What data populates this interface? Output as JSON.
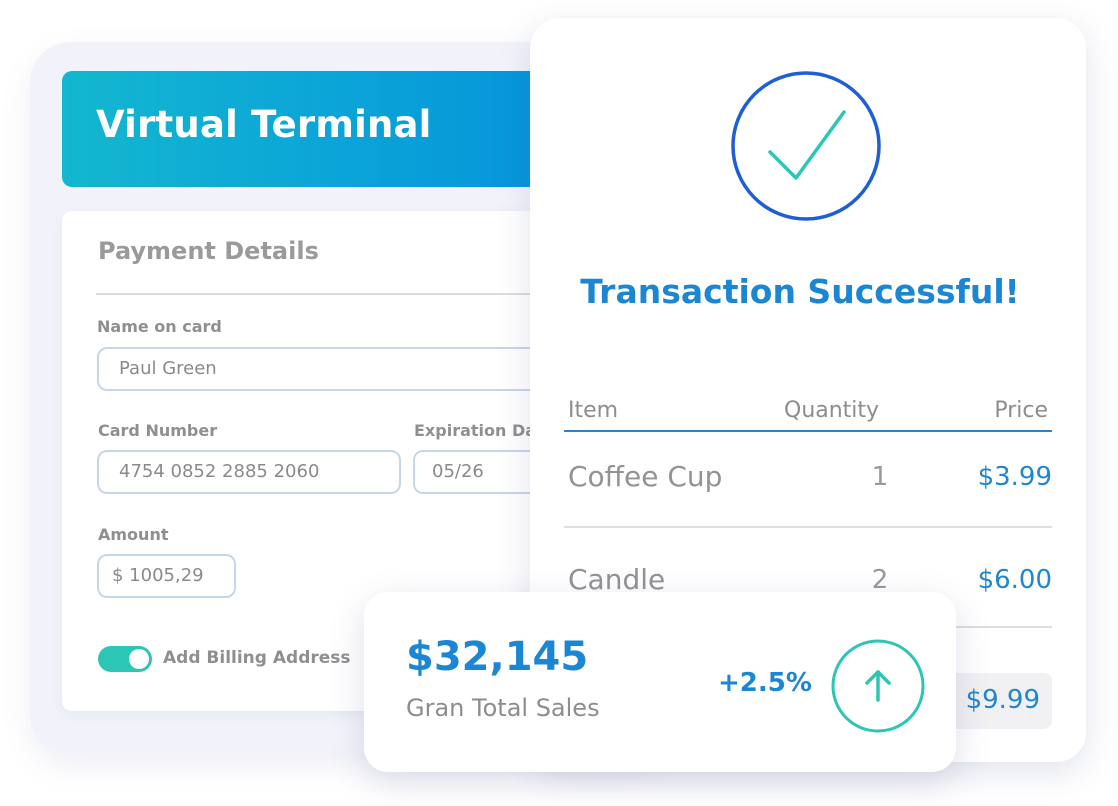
{
  "terminal": {
    "title": "Virtual Terminal",
    "section_title": "Payment Details",
    "name_label": "Name on card",
    "name_value": "Paul Green",
    "card_number_label": "Card Number",
    "card_number_value": "4754 0852 2885 2060",
    "expiration_label": "Expiration Dat",
    "expiration_value": "05/26",
    "amount_label": "Amount",
    "amount_value": "$ 1005,29",
    "billing_toggle_label": "Add Billing Address",
    "billing_toggle_on": true
  },
  "receipt": {
    "status_title": "Transaction Successful!",
    "columns": {
      "item": "Item",
      "quantity": "Quantity",
      "price": "Price"
    },
    "rows": [
      {
        "item": "Coffee Cup",
        "quantity": "1",
        "price": "$3.99"
      },
      {
        "item": "Candle",
        "quantity": "2",
        "price": "$6.00"
      }
    ],
    "total": "$9.99"
  },
  "sales": {
    "value": "$32,145",
    "label": "Gran Total Sales",
    "change": "+2.5%"
  },
  "colors": {
    "accent_blue": "#1a86d4",
    "accent_teal": "#2cc6b5",
    "banner_start": "#13b7cf",
    "banner_end": "#0590db",
    "success_ring": "#1e5fd8"
  },
  "icons": {
    "success": "check-circle-icon",
    "trend": "arrow-up-circle-icon"
  }
}
